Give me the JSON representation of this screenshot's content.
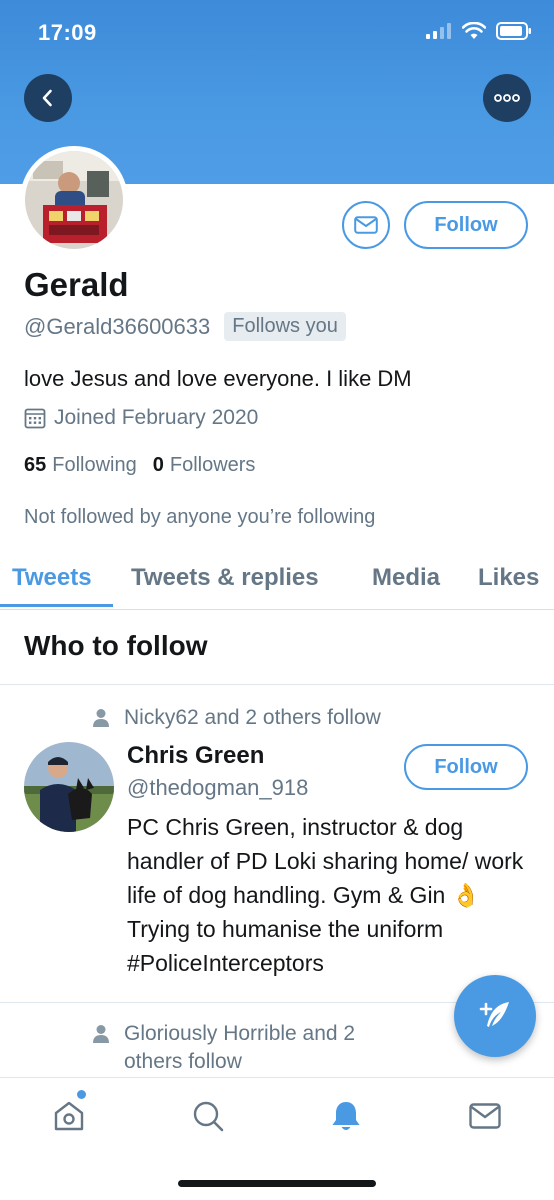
{
  "status_bar": {
    "time": "17:09"
  },
  "profile": {
    "name": "Gerald",
    "handle": "@Gerald36600633",
    "follows_you_badge": "Follows you",
    "bio": "love Jesus and love everyone. I like DM",
    "joined": "Joined February 2020",
    "following_count": "65",
    "following_label": "Following",
    "followers_count": "0",
    "followers_label": "Followers",
    "not_followed_note": "Not followed by anyone you’re following",
    "follow_button_label": "Follow"
  },
  "tabs": [
    {
      "label": "Tweets",
      "active": true
    },
    {
      "label": "Tweets & replies",
      "active": false
    },
    {
      "label": "Media",
      "active": false
    },
    {
      "label": "Likes",
      "active": false
    }
  ],
  "who_to_follow": {
    "title": "Who to follow",
    "items": [
      {
        "social_proof": "Nicky62 and 2 others follow",
        "name": "Chris Green",
        "handle": "@thedogman_918",
        "bio": "PC Chris Green, instructor & dog handler of PD Loki sharing home/ work life of dog handling. Gym & Gin 👌 Trying to humanise the uniform #PoliceInterceptors",
        "follow_label": "Follow"
      },
      {
        "social_proof_line1": "Gloriously Horrible and 2",
        "social_proof_line2": "others follow"
      }
    ]
  },
  "bottom_nav": [
    {
      "icon": "home-icon",
      "notification_dot": true
    },
    {
      "icon": "search-icon"
    },
    {
      "icon": "bell-icon",
      "active": true
    },
    {
      "icon": "mail-icon"
    }
  ],
  "colors": {
    "accent": "#4a99e3",
    "header_gradient_top": "#3d8bd9",
    "text_primary": "#14171a",
    "text_secondary": "#657786"
  }
}
